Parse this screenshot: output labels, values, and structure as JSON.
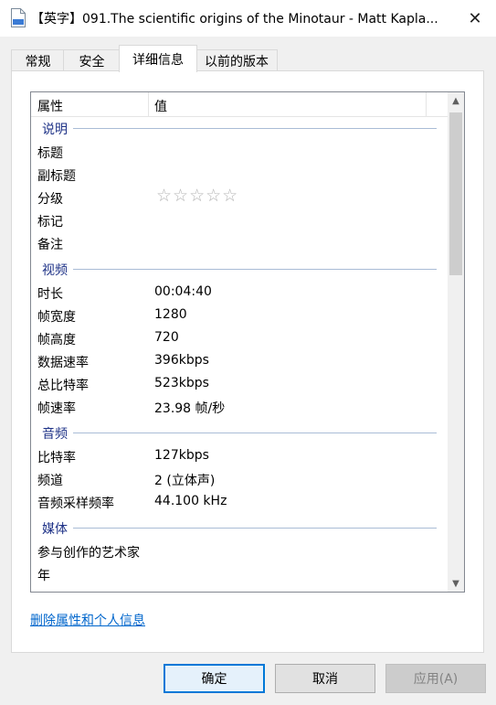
{
  "window": {
    "title": "【英字】091.The scientific origins of the Minotaur - Matt Kapla...",
    "close_symbol": "✕",
    "file_icon_label": "MP4"
  },
  "tabs": [
    {
      "label": "常规",
      "active": false
    },
    {
      "label": "安全",
      "active": false
    },
    {
      "label": "详细信息",
      "active": true
    },
    {
      "label": "以前的版本",
      "active": false
    }
  ],
  "list": {
    "header": {
      "property": "属性",
      "value": "值"
    },
    "sections": [
      {
        "title": "说明",
        "rows": [
          {
            "name": "标题",
            "value": ""
          },
          {
            "name": "副标题",
            "value": ""
          },
          {
            "name": "分级",
            "value": "",
            "rating": 0,
            "rating_max": 5,
            "star_glyphs": "☆☆☆☆☆"
          },
          {
            "name": "标记",
            "value": ""
          },
          {
            "name": "备注",
            "value": ""
          }
        ]
      },
      {
        "title": "视频",
        "rows": [
          {
            "name": "时长",
            "value": "00:04:40"
          },
          {
            "name": "帧宽度",
            "value": "1280"
          },
          {
            "name": "帧高度",
            "value": "720"
          },
          {
            "name": "数据速率",
            "value": "396kbps"
          },
          {
            "name": "总比特率",
            "value": "523kbps"
          },
          {
            "name": "帧速率",
            "value": "23.98 帧/秒"
          }
        ]
      },
      {
        "title": "音频",
        "rows": [
          {
            "name": "比特率",
            "value": "127kbps"
          },
          {
            "name": "频道",
            "value": "2 (立体声)"
          },
          {
            "name": "音频采样频率",
            "value": "44.100 kHz"
          }
        ]
      },
      {
        "title": "媒体",
        "rows": [
          {
            "name": "参与创作的艺术家",
            "value": ""
          },
          {
            "name": "年",
            "value": ""
          }
        ]
      }
    ],
    "scrollbar": {
      "up_symbol": "▲",
      "down_symbol": "▼"
    }
  },
  "remove_link": "删除属性和个人信息",
  "buttons": {
    "ok": "确定",
    "cancel": "取消",
    "apply": "应用(A)"
  },
  "colors": {
    "section_title": "#1e3287",
    "link": "#0066cc",
    "accent": "#0078d7"
  }
}
